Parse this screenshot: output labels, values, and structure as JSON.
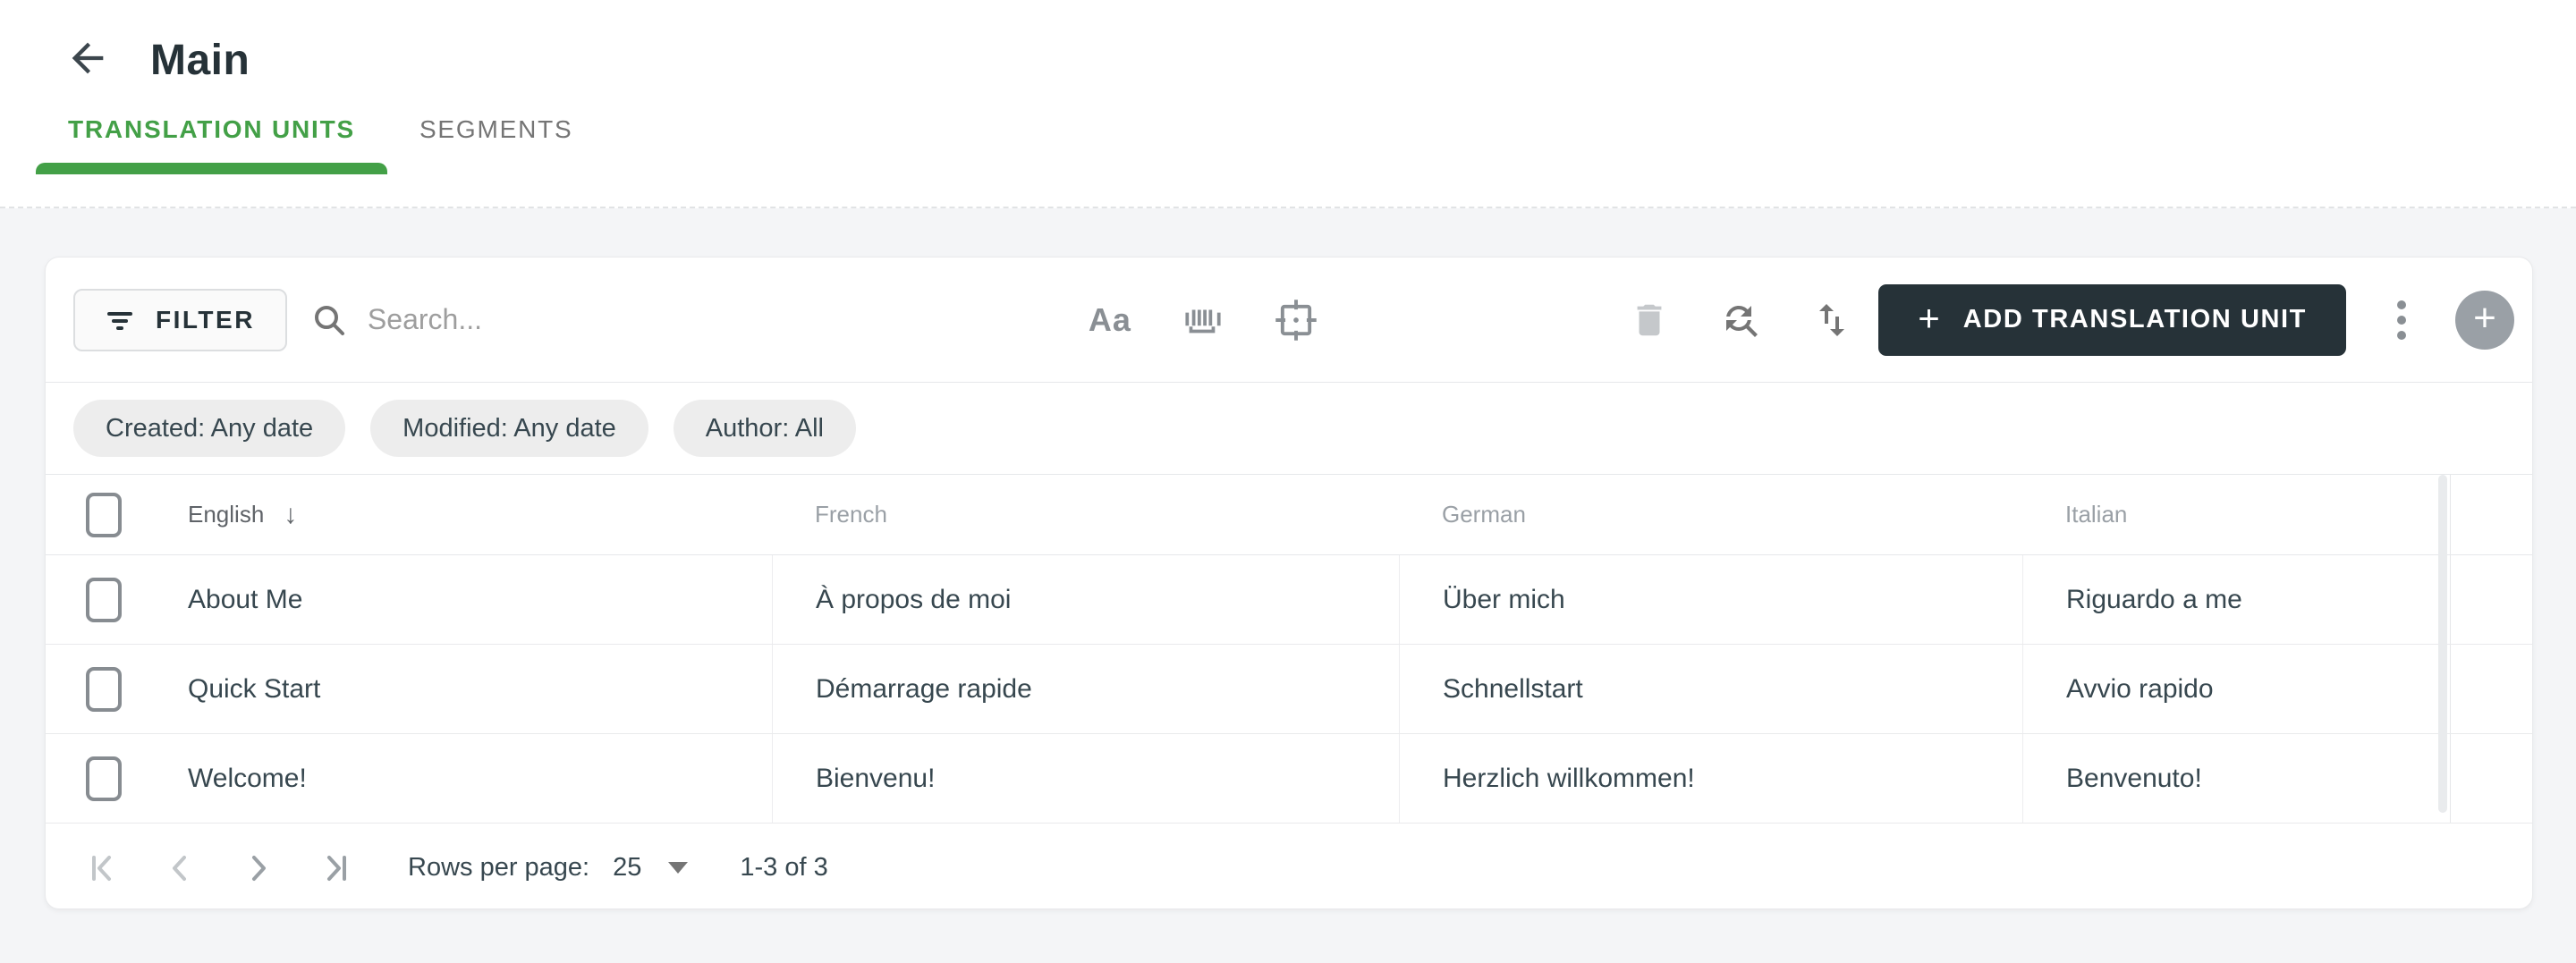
{
  "header": {
    "title": "Main"
  },
  "tabs": {
    "translation_units": "TRANSLATION UNITS",
    "segments": "SEGMENTS"
  },
  "toolbar": {
    "filter_label": "FILTER",
    "search_placeholder": "Search...",
    "match_case_label": "Aa",
    "add_button_label": "ADD TRANSLATION UNIT",
    "plus_glyph": "+",
    "icons": {
      "filter": "funnel-lines",
      "search": "magnifier",
      "match_case": "Aa-letters",
      "match_whole_word": "word-bars",
      "match_selection": "focus-frame-with-dot",
      "delete": "trash-can (disabled)",
      "find_replace": "circular-arrows-with-magnifier",
      "sort": "up-down-arrows",
      "more": "kebab-three-dots",
      "fab_add": "gray-circle-plus"
    }
  },
  "chips": {
    "created": "Created: Any date",
    "modified": "Modified: Any date",
    "author": "Author: All"
  },
  "table": {
    "columns": {
      "c0": "English",
      "c1": "French",
      "c2": "German",
      "c3": "Italian"
    },
    "sort": {
      "column": "English",
      "direction": "descending",
      "arrow": "↓"
    },
    "rows": [
      {
        "cells": [
          "About Me",
          "À propos de moi",
          "Über mich",
          "Riguardo a me"
        ]
      },
      {
        "cells": [
          "Quick Start",
          "Démarrage rapide",
          "Schnellstart",
          "Avvio rapido"
        ]
      },
      {
        "cells": [
          "Welcome!",
          "Bienvenu!",
          "Herzlich willkommen!",
          "Benvenuto!"
        ]
      }
    ]
  },
  "pagination": {
    "rows_per_page_label": "Rows per page:",
    "rows_per_page_value": "25",
    "range": "1-3 of 3",
    "icons": {
      "first": "bar-chevron-left",
      "previous": "chevron-left",
      "next": "chevron-right",
      "last": "chevron-right-bar"
    }
  },
  "colors": {
    "accent_green": "#43a047",
    "primary_dark": "#263238",
    "page_background": "#f4f5f7",
    "card_background": "#ffffff",
    "chip_background": "#ededed",
    "muted_text": "#9aa0a6",
    "body_text": "#37474f",
    "divider": "#e6e8ea",
    "disabled_icon": "#c5c8cb",
    "fab_background": "#9aa0a6"
  }
}
